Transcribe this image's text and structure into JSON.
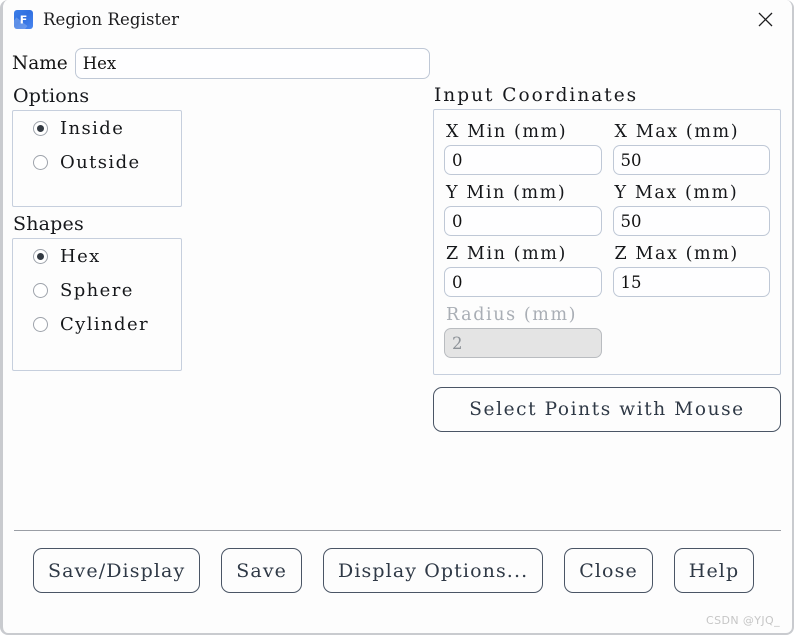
{
  "window": {
    "title": "Region Register",
    "app_icon": "app-f-icon",
    "close_icon": "close-icon"
  },
  "name_field": {
    "label": "Name",
    "value": "Hex",
    "placeholder": ""
  },
  "options": {
    "title": "Options",
    "items": [
      {
        "label": "Inside",
        "checked": true
      },
      {
        "label": "Outside",
        "checked": false
      }
    ]
  },
  "shapes": {
    "title": "Shapes",
    "items": [
      {
        "label": "Hex",
        "checked": true
      },
      {
        "label": "Sphere",
        "checked": false
      },
      {
        "label": "Cylinder",
        "checked": false
      }
    ]
  },
  "input_coordinates": {
    "title": "Input Coordinates",
    "fields": [
      {
        "label": "X Min (mm)",
        "value": "0",
        "disabled": false
      },
      {
        "label": "X Max (mm)",
        "value": "50",
        "disabled": false
      },
      {
        "label": "Y Min (mm)",
        "value": "0",
        "disabled": false
      },
      {
        "label": "Y Max (mm)",
        "value": "50",
        "disabled": false
      },
      {
        "label": "Z Min (mm)",
        "value": "0",
        "disabled": false
      },
      {
        "label": "Z Max (mm)",
        "value": "15",
        "disabled": false
      },
      {
        "label": "Radius (mm)",
        "value": "2",
        "disabled": true
      }
    ],
    "select_points_label": "Select Points with Mouse"
  },
  "footer": {
    "buttons": [
      {
        "label": "Save/Display"
      },
      {
        "label": "Save"
      },
      {
        "label": "Display Options..."
      },
      {
        "label": "Close"
      },
      {
        "label": "Help"
      }
    ]
  },
  "watermark": "CSDN @YJQ_",
  "colors": {
    "accent": "#3d7fe8",
    "button_border": "#4a5565",
    "input_border": "#bfc8d6",
    "group_border": "#c6cfdd",
    "disabled_text": "#8d9298"
  }
}
